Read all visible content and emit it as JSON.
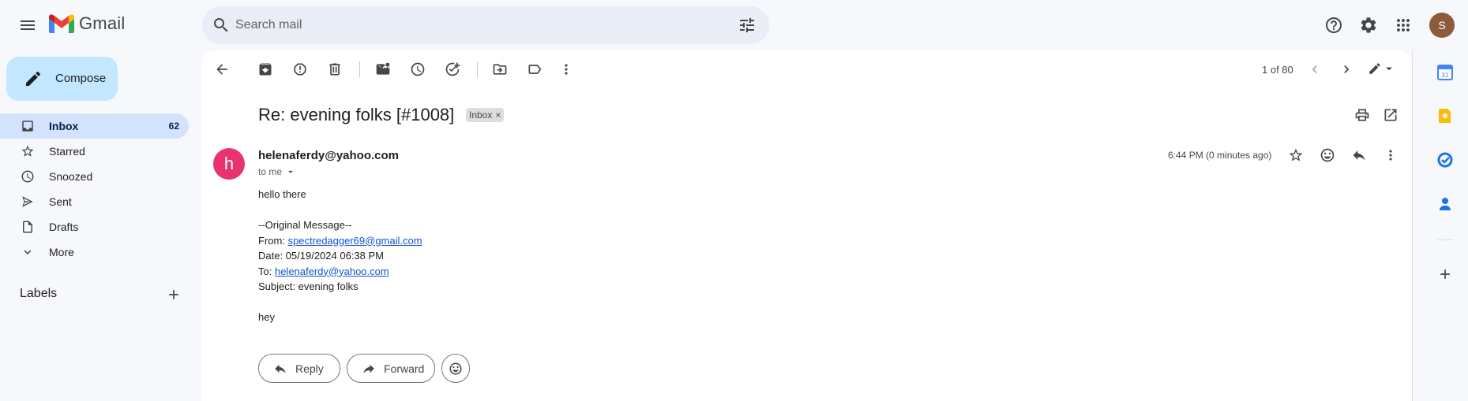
{
  "header": {
    "app_name": "Gmail",
    "search_placeholder": "Search mail",
    "avatar_initial": "S"
  },
  "sidebar": {
    "compose_label": "Compose",
    "items": [
      {
        "label": "Inbox",
        "count": "62",
        "icon": "inbox-icon",
        "active": true
      },
      {
        "label": "Starred",
        "count": "",
        "icon": "star-icon"
      },
      {
        "label": "Snoozed",
        "count": "",
        "icon": "clock-icon"
      },
      {
        "label": "Sent",
        "count": "",
        "icon": "send-icon"
      },
      {
        "label": "Drafts",
        "count": "",
        "icon": "draft-icon"
      },
      {
        "label": "More",
        "count": "",
        "icon": "chevron-down-icon"
      }
    ],
    "labels_title": "Labels"
  },
  "toolbar": {
    "page_count": "1 of 80"
  },
  "email": {
    "subject": "Re: evening folks [#1008]",
    "label_chip": "Inbox",
    "label_chip_close": "×",
    "sender_initial": "h",
    "sender": "helenaferdy@yahoo.com",
    "recipient": "to me",
    "time": "6:44 PM (0 minutes ago)",
    "body": {
      "greeting": "hello there",
      "original_header": "--Original Message--",
      "from_label": "From: ",
      "from_link": "spectredagger69@gmail.com",
      "date_line": "Date: 05/19/2024 06:38 PM",
      "to_label": "To: ",
      "to_link": "helenaferdy@yahoo.com",
      "subject_line": "Subject: evening folks",
      "closing": "hey"
    },
    "reply_label": "Reply",
    "forward_label": "Forward"
  },
  "colors": {
    "compose_bg": "#c2e7ff",
    "active_nav_bg": "#d3e3fd",
    "sender_avatar": "#e8336e",
    "user_avatar": "#8d5a3c",
    "link": "#1155cc"
  }
}
